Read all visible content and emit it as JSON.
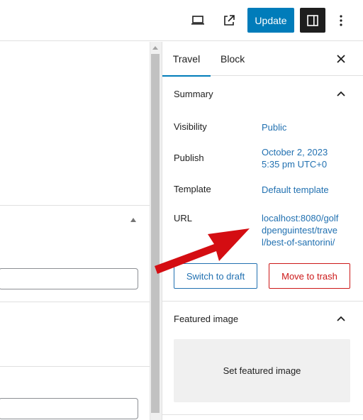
{
  "toolbar": {
    "preview_icon": "laptop-icon",
    "view_post_icon": "external-link-icon",
    "update_label": "Update",
    "settings_icon": "sidebar-panel-icon",
    "more_icon": "vertical-ellipsis-icon"
  },
  "sidebar": {
    "tabs": [
      {
        "label": "Travel"
      },
      {
        "label": "Block"
      }
    ],
    "close_icon": "close-icon",
    "summary": {
      "title": "Summary",
      "rows": [
        {
          "label": "Visibility",
          "value": "Public"
        },
        {
          "label": "Publish",
          "value": "October 2, 2023 5:35 pm UTC+0"
        },
        {
          "label": "Template",
          "value": "Default template"
        },
        {
          "label": "URL",
          "value": "localhost:8080/golf dpenguintest/travel/best-of-santorini/"
        }
      ],
      "switch_draft_label": "Switch to draft",
      "move_trash_label": "Move to trash"
    },
    "featured": {
      "title": "Featured image",
      "set_label": "Set featured image"
    }
  },
  "colors": {
    "accent": "#007cba",
    "link": "#2271b1",
    "danger": "#cc1818",
    "annotation_arrow": "#d40d12"
  }
}
